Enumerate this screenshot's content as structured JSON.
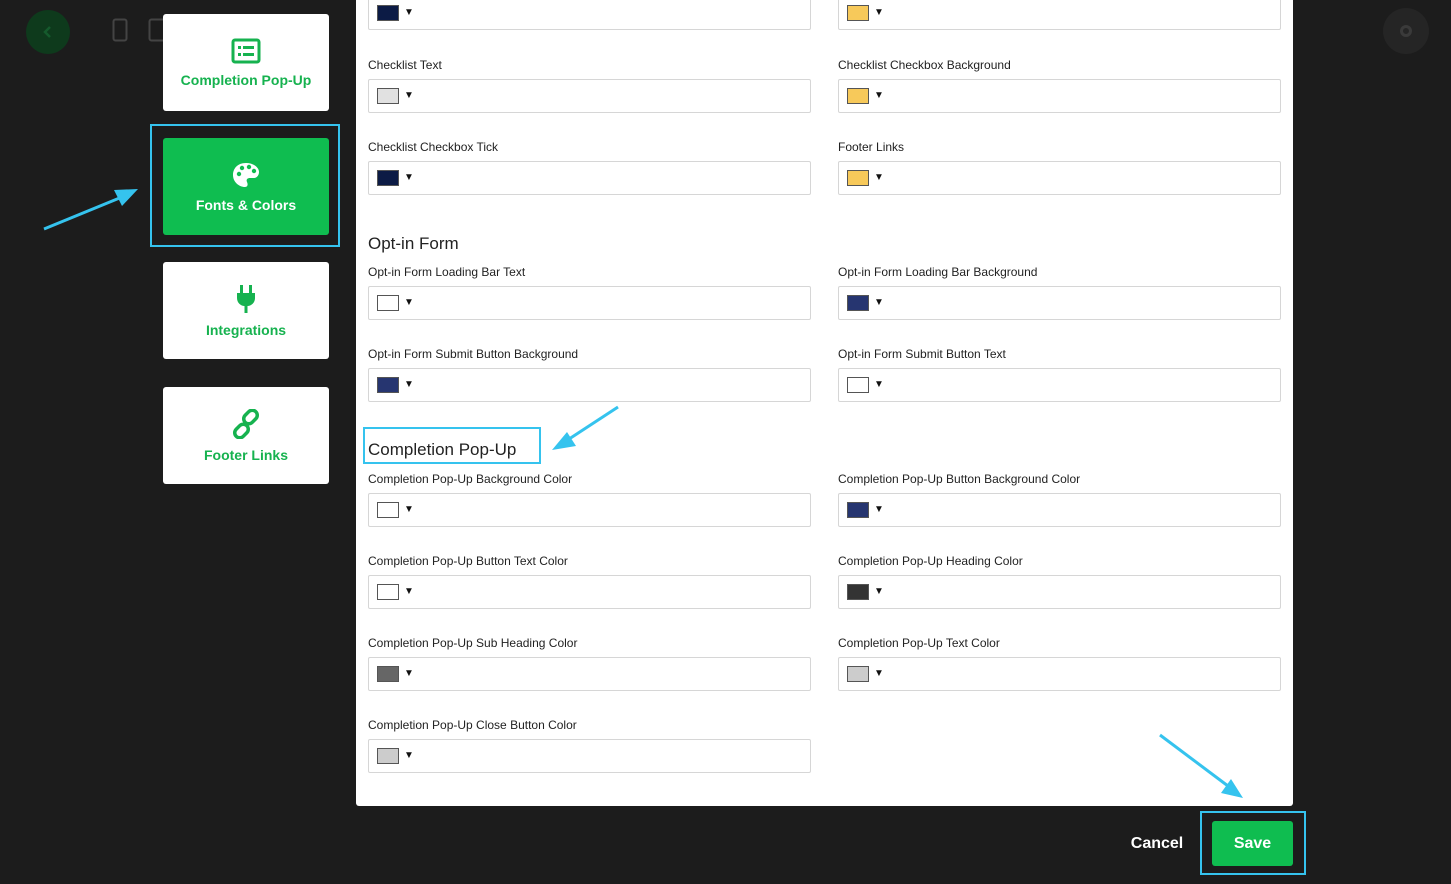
{
  "sidebar": {
    "cards": [
      {
        "label": "Completion Pop-Up",
        "icon": "list-icon"
      },
      {
        "label": "Fonts & Colors",
        "icon": "palette-icon",
        "active": true
      },
      {
        "label": "Integrations",
        "icon": "plug-icon"
      },
      {
        "label": "Footer Links",
        "icon": "link-icon"
      }
    ]
  },
  "top_fields": [
    {
      "label": "",
      "color": "#0c1b45"
    },
    {
      "label": "",
      "color": "#f7c95a"
    },
    {
      "label": "Checklist Text",
      "color": "#e1e1e1"
    },
    {
      "label": "Checklist Checkbox Background",
      "color": "#f7c95a"
    },
    {
      "label": "Checklist Checkbox Tick",
      "color": "#0c1b45"
    },
    {
      "label": "Footer Links",
      "color": "#f7c95a"
    }
  ],
  "optin": {
    "title": "Opt-in Form",
    "fields": [
      {
        "label": "Opt-in Form Loading Bar Text",
        "color": "#ffffff"
      },
      {
        "label": "Opt-in Form Loading Bar Background",
        "color": "#263570"
      },
      {
        "label": "Opt-in Form Submit Button Background",
        "color": "#263570"
      },
      {
        "label": "Opt-in Form Submit Button Text",
        "color": "#ffffff"
      }
    ]
  },
  "completion": {
    "title": "Completion Pop-Up",
    "fields": [
      {
        "label": "Completion Pop-Up Background Color",
        "color": "#ffffff"
      },
      {
        "label": "Completion Pop-Up Button Background Color",
        "color": "#263570"
      },
      {
        "label": "Completion Pop-Up Button Text Color",
        "color": "#ffffff"
      },
      {
        "label": "Completion Pop-Up Heading Color",
        "color": "#333333"
      },
      {
        "label": "Completion Pop-Up Sub Heading Color",
        "color": "#666666"
      },
      {
        "label": "Completion Pop-Up Text Color",
        "color": "#cccccc"
      },
      {
        "label": "Completion Pop-Up Close Button Color",
        "color": "#cccccc"
      }
    ]
  },
  "footer": {
    "cancel_label": "Cancel",
    "save_label": "Save"
  },
  "colors": {
    "brand_green": "#0fbd50",
    "annotation_blue": "#35c3ee"
  }
}
